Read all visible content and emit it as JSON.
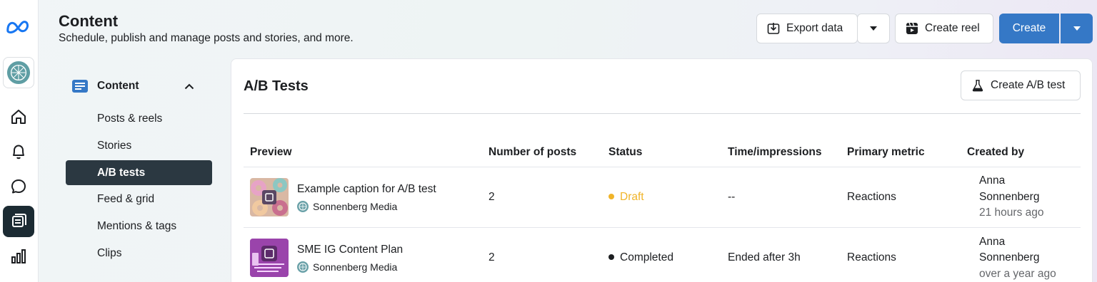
{
  "header": {
    "title": "Content",
    "subtitle": "Schedule, publish and manage posts and stories, and more."
  },
  "toolbar": {
    "export_label": "Export data",
    "create_reel_label": "Create reel",
    "create_label": "Create"
  },
  "rail": {
    "items": [
      "meta-logo",
      "page-avatar",
      "home",
      "notifications",
      "inbox",
      "content",
      "insights"
    ],
    "active": "content"
  },
  "subnav": {
    "section_label": "Content",
    "items": [
      {
        "label": "Posts & reels",
        "active": false
      },
      {
        "label": "Stories",
        "active": false
      },
      {
        "label": "A/B tests",
        "active": true
      },
      {
        "label": "Feed & grid",
        "active": false
      },
      {
        "label": "Mentions & tags",
        "active": false
      },
      {
        "label": "Clips",
        "active": false
      }
    ]
  },
  "main": {
    "title": "A/B Tests",
    "create_ab_label": "Create A/B test",
    "columns": [
      "Preview",
      "Number of posts",
      "Status",
      "Time/impressions",
      "Primary metric",
      "Created by"
    ],
    "rows": [
      {
        "caption": "Example caption for A/B test",
        "page": "Sonnenberg Media",
        "posts": "2",
        "status": "Draft",
        "status_color": "#f0b429",
        "time": "--",
        "metric": "Reactions",
        "creator_first": "Anna",
        "creator_last": "Sonnenberg",
        "created_when": "21 hours ago"
      },
      {
        "caption": "SME IG Content Plan",
        "page": "Sonnenberg Media",
        "posts": "2",
        "status": "Completed",
        "status_color": "#1c1e21",
        "time": "Ended after 3h",
        "metric": "Reactions",
        "creator_first": "Anna",
        "creator_last": "Sonnenberg",
        "created_when": "over a year ago"
      }
    ]
  },
  "colors": {
    "primary": "#3578c6",
    "active_nav": "#2b3841",
    "draft": "#f0b429"
  }
}
